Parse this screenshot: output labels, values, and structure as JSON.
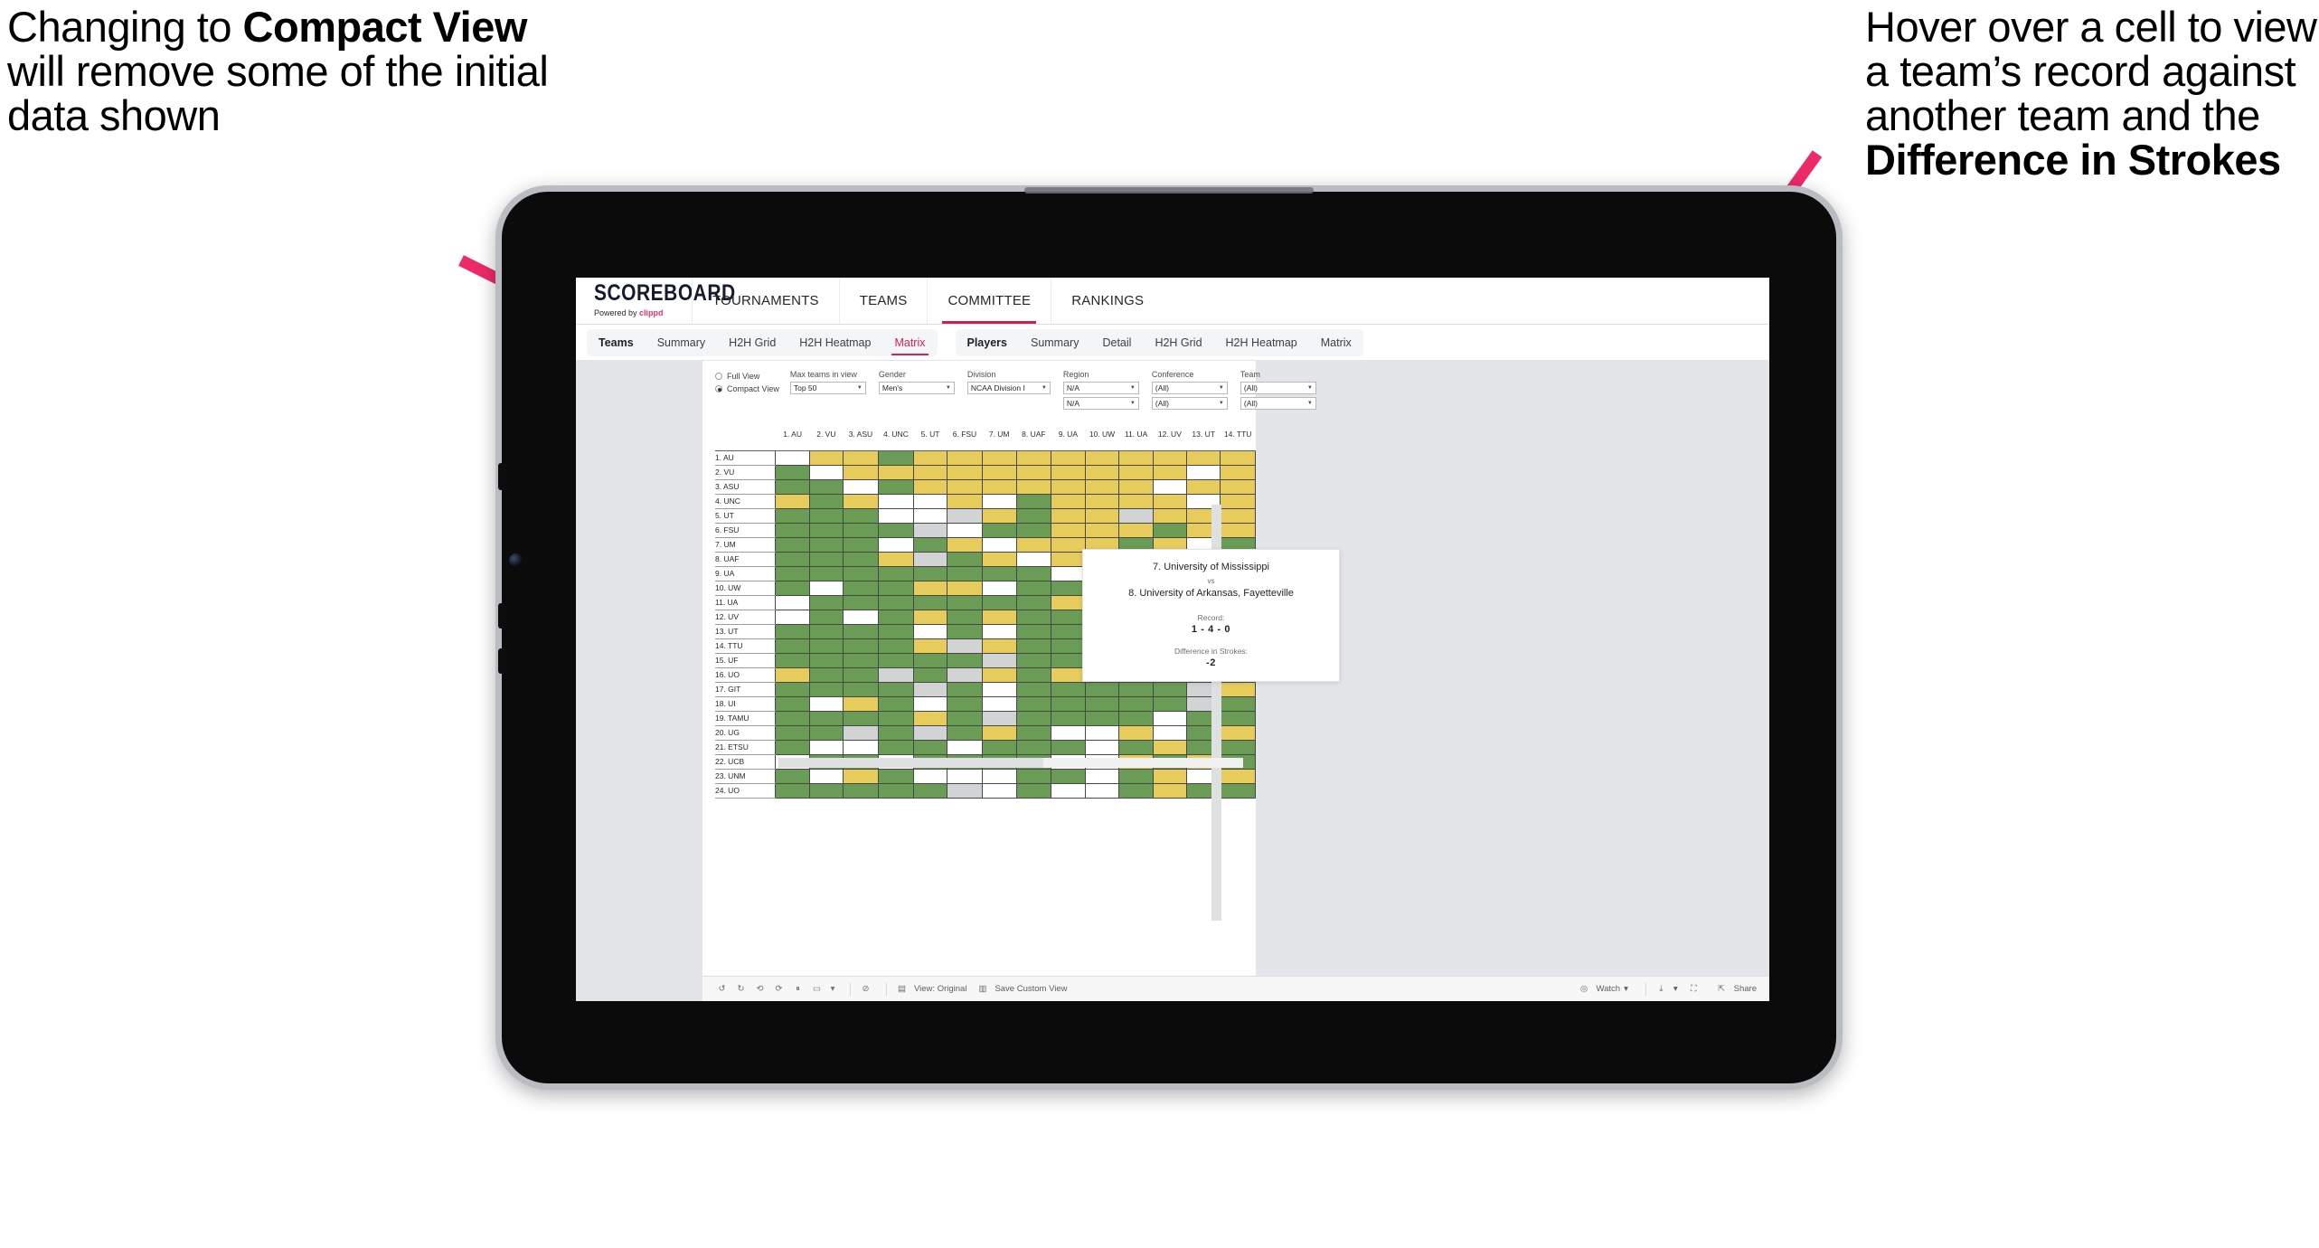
{
  "annotations": {
    "left": {
      "pre": "Changing to ",
      "bold": "Compact View",
      "post": " will remove some of the initial data shown"
    },
    "right": {
      "pre": "Hover over a cell to view a team’s record against another team and the ",
      "bold": "Difference in Strokes",
      "post": ""
    }
  },
  "app": {
    "brand": {
      "title": "SCOREBOARD",
      "powered_prefix": "Powered by ",
      "powered_name": "clippd"
    },
    "main_nav": [
      "TOURNAMENTS",
      "TEAMS",
      "COMMITTEE",
      "RANKINGS"
    ],
    "main_nav_active": "COMMITTEE",
    "subtabs_teams": {
      "group": "Teams",
      "items": [
        "Summary",
        "H2H Grid",
        "H2H Heatmap",
        "Matrix"
      ],
      "selected": "Matrix"
    },
    "subtabs_players": {
      "group": "Players",
      "items": [
        "Summary",
        "Detail",
        "H2H Grid",
        "H2H Heatmap",
        "Matrix"
      ],
      "selected": ""
    }
  },
  "filters": {
    "view_mode": {
      "options": [
        "Full View",
        "Compact View"
      ],
      "selected": "Compact View"
    },
    "controls": [
      {
        "label": "Max teams in view",
        "value": "Top 50",
        "value2": null
      },
      {
        "label": "Gender",
        "value": "Men's",
        "value2": null
      },
      {
        "label": "Division",
        "value": "NCAA Division I",
        "value2": null
      },
      {
        "label": "Region",
        "value": "N/A",
        "value2": "N/A"
      },
      {
        "label": "Conference",
        "value": "(All)",
        "value2": "(All)"
      },
      {
        "label": "Team",
        "value": "(All)",
        "value2": "(All)"
      }
    ]
  },
  "matrix": {
    "columns": [
      "1. AU",
      "2. VU",
      "3. ASU",
      "4. UNC",
      "5. UT",
      "6. FSU",
      "7. UM",
      "8. UAF",
      "9. UA",
      "10. UW",
      "11. UA",
      "12. UV",
      "13. UT",
      "14. TTU"
    ],
    "rows": [
      "1. AU",
      "2. VU",
      "3. ASU",
      "4. UNC",
      "5. UT",
      "6. FSU",
      "7. UM",
      "8. UAF",
      "9. UA",
      "10. UW",
      "11. UA",
      "12. UV",
      "13. UT",
      "14. TTU",
      "15. UF",
      "16. UO",
      "17. GIT",
      "18. UI",
      "19. TAMU",
      "20. UG",
      "21. ETSU",
      "22. UCB",
      "23. UNM",
      "24. UO"
    ],
    "legend": {
      "win": "#6a9c55",
      "loss": "#e7cc5c",
      "tie": "#d2d3d5",
      "none": "#ffffff"
    },
    "cells": [
      [
        "n",
        "y",
        "y",
        "g",
        "y",
        "y",
        "y",
        "y",
        "y",
        "y",
        "y",
        "y",
        "y",
        "y"
      ],
      [
        "g",
        "n",
        "y",
        "y",
        "y",
        "y",
        "y",
        "y",
        "y",
        "y",
        "y",
        "y",
        "w",
        "y"
      ],
      [
        "g",
        "g",
        "n",
        "g",
        "y",
        "y",
        "y",
        "y",
        "y",
        "y",
        "y",
        "w",
        "y",
        "y"
      ],
      [
        "y",
        "g",
        "y",
        "n",
        "w",
        "y",
        "w",
        "g",
        "y",
        "y",
        "y",
        "y",
        "w",
        "y"
      ],
      [
        "g",
        "g",
        "g",
        "w",
        "n",
        "k",
        "y",
        "g",
        "y",
        "y",
        "k",
        "y",
        "y",
        "y"
      ],
      [
        "g",
        "g",
        "g",
        "g",
        "k",
        "n",
        "g",
        "g",
        "y",
        "y",
        "y",
        "g",
        "y",
        "y"
      ],
      [
        "g",
        "g",
        "g",
        "w",
        "g",
        "y",
        "n",
        "y",
        "y",
        "y",
        "g",
        "y",
        "w",
        "g"
      ],
      [
        "g",
        "g",
        "g",
        "y",
        "k",
        "g",
        "y",
        "n",
        "y",
        "y",
        "w",
        "y",
        "y",
        "k"
      ],
      [
        "g",
        "g",
        "g",
        "g",
        "g",
        "g",
        "g",
        "g",
        "n",
        "g",
        "y",
        "y",
        "y",
        "g"
      ],
      [
        "g",
        "w",
        "g",
        "g",
        "y",
        "y",
        "w",
        "g",
        "g",
        "n",
        "y",
        "y",
        "y",
        "y"
      ],
      [
        "w",
        "g",
        "g",
        "g",
        "g",
        "g",
        "g",
        "g",
        "y",
        "g",
        "n",
        "g",
        "y",
        "k"
      ],
      [
        "w",
        "g",
        "w",
        "g",
        "y",
        "g",
        "y",
        "g",
        "g",
        "y",
        "g",
        "n",
        "g",
        "y"
      ],
      [
        "g",
        "g",
        "g",
        "g",
        "w",
        "g",
        "w",
        "g",
        "g",
        "g",
        "w",
        "g",
        "n",
        "g"
      ],
      [
        "g",
        "g",
        "g",
        "g",
        "y",
        "k",
        "y",
        "g",
        "g",
        "g",
        "w",
        "g",
        "g",
        "n"
      ],
      [
        "g",
        "g",
        "g",
        "g",
        "g",
        "g",
        "k",
        "g",
        "g",
        "g",
        "w",
        "w",
        "w",
        "w"
      ],
      [
        "y",
        "g",
        "g",
        "k",
        "g",
        "k",
        "y",
        "g",
        "y",
        "g",
        "g",
        "y",
        "w",
        "y"
      ],
      [
        "g",
        "g",
        "g",
        "g",
        "k",
        "g",
        "w",
        "g",
        "g",
        "g",
        "g",
        "g",
        "k",
        "y"
      ],
      [
        "g",
        "w",
        "y",
        "g",
        "w",
        "g",
        "w",
        "g",
        "g",
        "g",
        "g",
        "g",
        "k",
        "g"
      ],
      [
        "g",
        "g",
        "g",
        "g",
        "y",
        "g",
        "k",
        "g",
        "g",
        "g",
        "g",
        "w",
        "g",
        "g"
      ],
      [
        "g",
        "g",
        "k",
        "g",
        "k",
        "g",
        "y",
        "g",
        "w",
        "w",
        "y",
        "w",
        "g",
        "y"
      ],
      [
        "g",
        "w",
        "w",
        "g",
        "g",
        "w",
        "g",
        "g",
        "g",
        "w",
        "g",
        "y",
        "g",
        "g"
      ],
      [
        "w",
        "g",
        "g",
        "w",
        "g",
        "g",
        "g",
        "g",
        "w",
        "w",
        "y",
        "g",
        "y",
        "g"
      ],
      [
        "g",
        "w",
        "y",
        "g",
        "w",
        "w",
        "w",
        "g",
        "g",
        "w",
        "g",
        "y",
        "w",
        "y"
      ],
      [
        "g",
        "g",
        "g",
        "g",
        "g",
        "k",
        "w",
        "g",
        "w",
        "w",
        "g",
        "y",
        "g",
        "g"
      ]
    ]
  },
  "tooltip": {
    "team_a": "7. University of Mississippi",
    "vs": "vs",
    "team_b": "8. University of Arkansas, Fayetteville",
    "record_label": "Record:",
    "record_value": "1 - 4 - 0",
    "strokes_label": "Difference in Strokes:",
    "strokes_value": "-2"
  },
  "toolbar": {
    "view_original": "View: Original",
    "save_custom_view": "Save Custom View",
    "watch": "Watch",
    "share": "Share"
  }
}
